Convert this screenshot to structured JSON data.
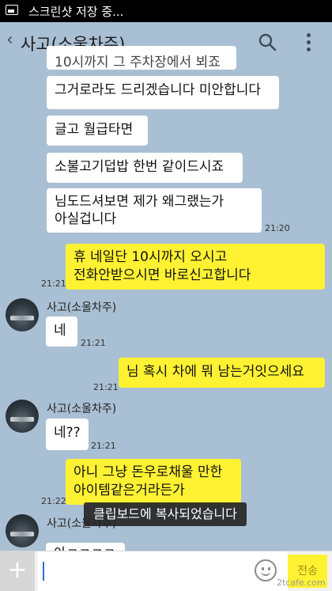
{
  "status_bar": {
    "text": "스크린샷 저장 중..."
  },
  "header": {
    "title": "사고(소울차주)"
  },
  "messages": {
    "partial_top": "10시까지 그 주차장에서 뵈죠",
    "m1": "그거로라도 드리겠습니다 미안합니다",
    "m2": "글고 월급타면",
    "m3": "소불고기덥밥 한번  같이드시죠",
    "m4": "님도드셔보면 제가 왜그랬는가\n아실겁니다",
    "m4_time": "21:20",
    "m5": "휴 네일단 10시까지 오시고\n전화안받으시면 바로신고합니다",
    "m5_time": "21:21",
    "sender1": "사고(소울차주)",
    "m6": "네",
    "m6_time": "21:21",
    "m7": "님 혹시 차에 뭐 남는거잇으세요",
    "m7_time": "21:21",
    "sender2": "사고(소울차주)",
    "m8": "네??",
    "m8_time": "21:21",
    "m9": "아니 그냥 돈우로채울 만한\n아이템같은거라든가",
    "m9_time": "21:22",
    "sender3": "사고(소울차주)",
    "m10_partial": "아ㅋㅋㅋㅋ"
  },
  "toast": "클립보드에 복사되었습니다",
  "input": {
    "send_label": "전송"
  },
  "watermark": "2tcafe.com"
}
